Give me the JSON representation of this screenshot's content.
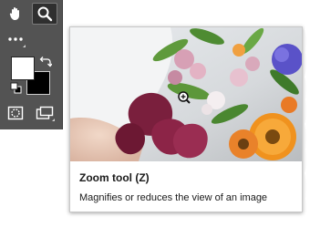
{
  "toolbar": {
    "tools": [
      {
        "name": "hand-tool",
        "icon": "hand-icon"
      },
      {
        "name": "zoom-tool",
        "icon": "magnifier-icon",
        "active": true
      },
      {
        "name": "more-tools",
        "icon": "ellipsis-icon"
      }
    ],
    "foreground_color": "#ffffff",
    "background_color": "#000000",
    "bottom_tools": [
      {
        "name": "quick-mask",
        "icon": "quick-mask-icon"
      },
      {
        "name": "screen-mode",
        "icon": "screen-mode-icon"
      }
    ]
  },
  "tooltip": {
    "title": "Zoom tool (Z)",
    "description": "Magnifies or reduces the view of an image",
    "preview_icon": "zoom-in-cursor-icon"
  },
  "colors": {
    "toolbar_bg": "#535353",
    "active_tool_bg": "#2f2f2f"
  }
}
